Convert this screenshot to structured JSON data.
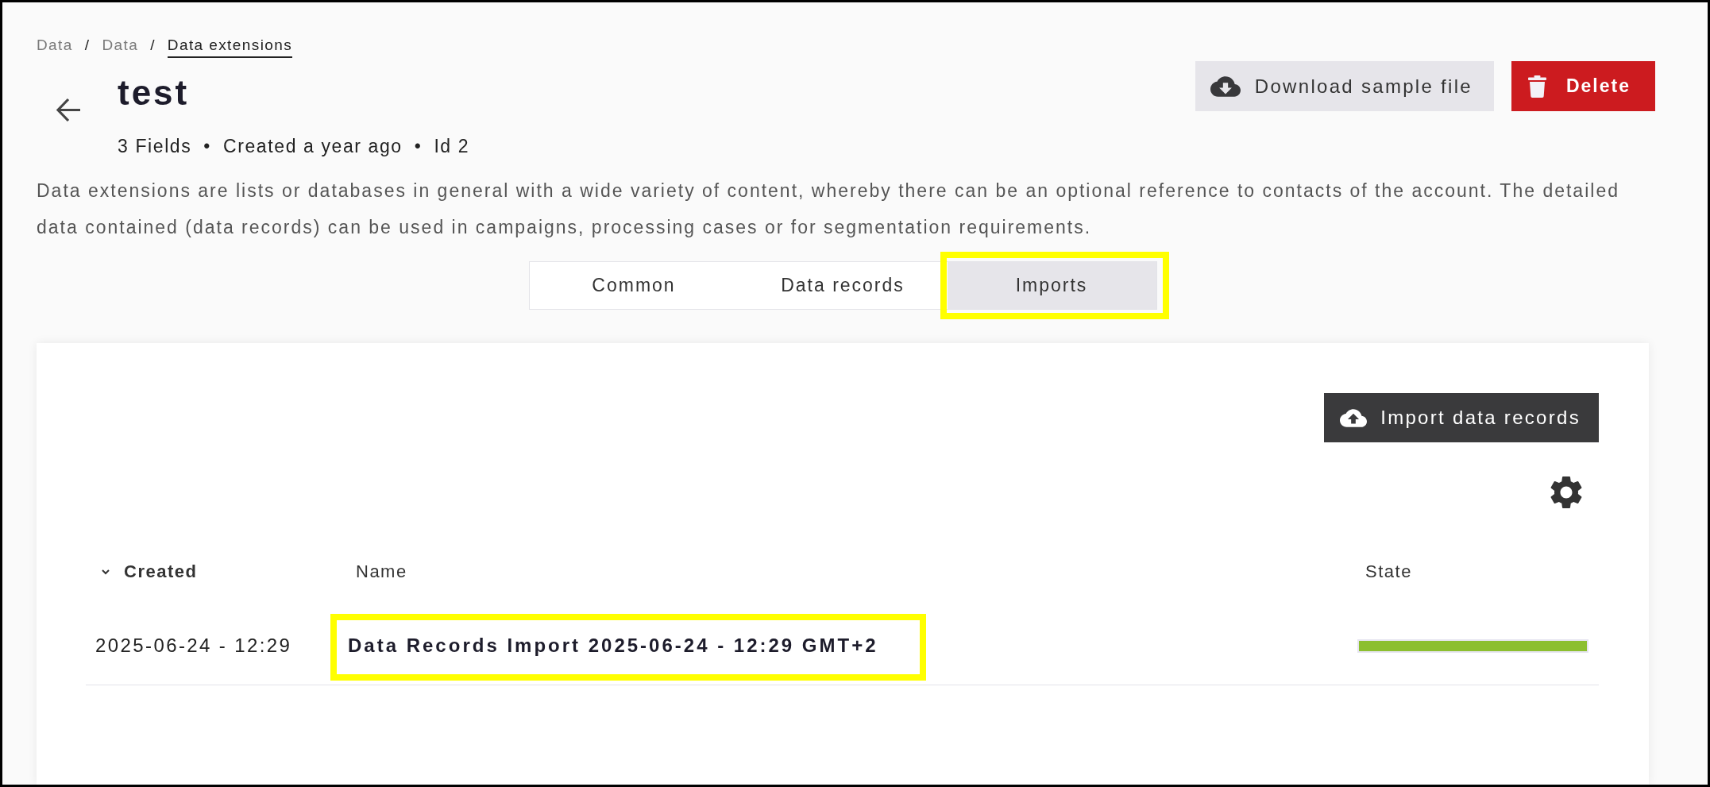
{
  "breadcrumb": [
    {
      "label": "Data",
      "current": false
    },
    {
      "separator": "/",
      "label": "Data",
      "current": false
    },
    {
      "separator": "/",
      "label": "Data extensions",
      "current": true
    }
  ],
  "header": {
    "title": "test",
    "meta": [
      {
        "text": "3 Fields"
      },
      {
        "separator": "•",
        "text": "Created a year ago"
      },
      {
        "separator": "•",
        "text": "Id 2"
      }
    ],
    "actions": [
      {
        "kind": "download",
        "label": "Download sample file"
      },
      {
        "kind": "delete",
        "label": "Delete"
      }
    ]
  },
  "description": "Data extensions are lists or databases in general with a wide variety of content, whereby there can be an optional reference to contacts of the account. The detailed data contained (data records) can be used in campaigns, processing cases or for segmentation requirements.",
  "tabs": [
    {
      "label": "Common",
      "selected": false,
      "highlighted": false
    },
    {
      "label": "Data records",
      "selected": false,
      "highlighted": false
    },
    {
      "label": "Imports",
      "selected": true,
      "highlighted": true
    }
  ],
  "imports": {
    "actions": [
      {
        "kind": "upload",
        "label": "Import data records"
      }
    ],
    "table": {
      "columns": [
        {
          "label": "Created",
          "sorted": true
        },
        {
          "label": "Name",
          "sorted": false
        },
        {
          "label": "State",
          "sorted": false
        }
      ],
      "rows": [
        {
          "created": "2025-06-24 - 12:29",
          "name": "Data Records Import 2025-06-24 - 12:29 GMT+2",
          "name_highlighted": true,
          "level": 1
        }
      ]
    }
  }
}
